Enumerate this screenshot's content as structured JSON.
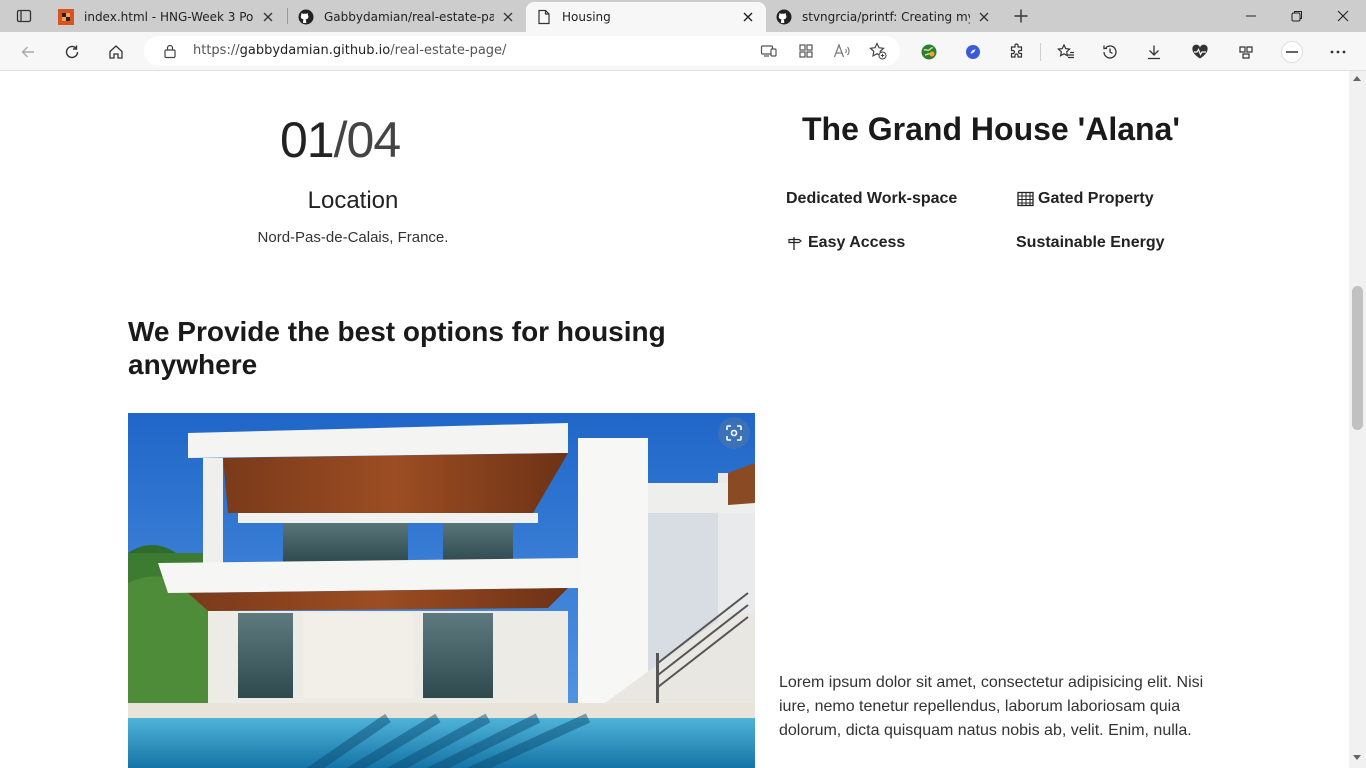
{
  "browser": {
    "tabs": [
      {
        "title": "index.html - HNG-Week 3 Portfo",
        "favicon": "checker-favicon",
        "active": false
      },
      {
        "title": "Gabbydamian/real-estate-page:",
        "favicon": "github-icon",
        "active": false
      },
      {
        "title": "Housing",
        "favicon": "page-icon",
        "active": true
      },
      {
        "title": "stvngrcia/printf: Creating my ow",
        "favicon": "github-icon",
        "active": false
      }
    ],
    "url_prefix": "https://",
    "url_host": "gabbydamian.github.io",
    "url_path": "/real-estate-page/",
    "colors": {
      "tabbar": "#cdcdcd",
      "toolbar": "#f7f7f7"
    }
  },
  "page": {
    "counter": {
      "current": "01",
      "separator": "/",
      "total": "04"
    },
    "location_label": "Location",
    "location_value": "Nord-Pas-de-Calais, France.",
    "house_title": "The Grand House 'Alana'",
    "features": [
      {
        "label": "Dedicated Work-space",
        "icon": ""
      },
      {
        "label": "Gated Property",
        "icon": "gate-icon"
      },
      {
        "label": "Easy Access",
        "icon": "signpost-icon"
      },
      {
        "label": "Sustainable Energy",
        "icon": ""
      }
    ],
    "heading": "We Provide the best options for housing anywhere",
    "paragraph": "Lorem ipsum dolor sit amet, consectetur adipisicing elit. Nisi iure, nemo tenetur repellendus, laborum laboriosam quia dolorum, dicta quisquam natus nobis ab, velit. Enim, nulla."
  }
}
